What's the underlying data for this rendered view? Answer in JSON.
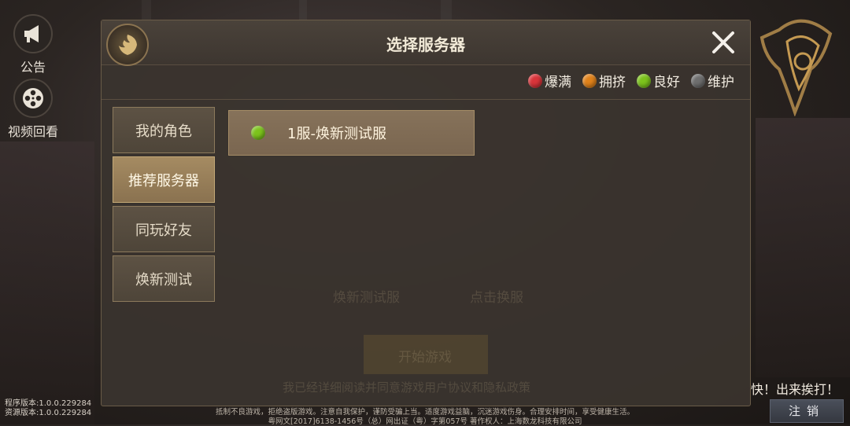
{
  "side": {
    "announce_label": "公告",
    "video_label": "视频回看"
  },
  "version": {
    "program": "程序版本:1.0.0.229284",
    "resource": "资源版本:1.0.0.229284"
  },
  "footer": {
    "line1": "抵制不良游戏，拒绝盗版游戏。注意自我保护，谨防受骗上当。适度游戏益脑，沉迷游戏伤身。合理安排时间，享受健康生活。",
    "line2": "粤网文[2017]6138-1456号（总）网出证（粤）字第057号 著作权人：上海数龙科技有限公司"
  },
  "dialog": {
    "title": "选择服务器",
    "legend": [
      {
        "label": "爆满",
        "color": "#d9343a"
      },
      {
        "label": "拥挤",
        "color": "#e0821a"
      },
      {
        "label": "良好",
        "color": "#7cc31c"
      },
      {
        "label": "维护",
        "color": "#6e6e6e"
      }
    ],
    "tabs": [
      {
        "label": "我的角色"
      },
      {
        "label": "推荐服务器"
      },
      {
        "label": "同玩好友"
      },
      {
        "label": "焕新测试"
      }
    ],
    "active_tab": "推荐服务器",
    "servers": [
      {
        "name": "1服-焕新测试服",
        "status_color": "#7cc31c"
      }
    ]
  },
  "background_ui": {
    "server_text": "焕新测试服",
    "switch_text": "点击换服",
    "enter_text": "开始游戏",
    "agree_text": "我已经详细阅读并同意游戏用户协议和隐私政策"
  },
  "tagline": "快！出来挨打！",
  "logout_label": "注销"
}
